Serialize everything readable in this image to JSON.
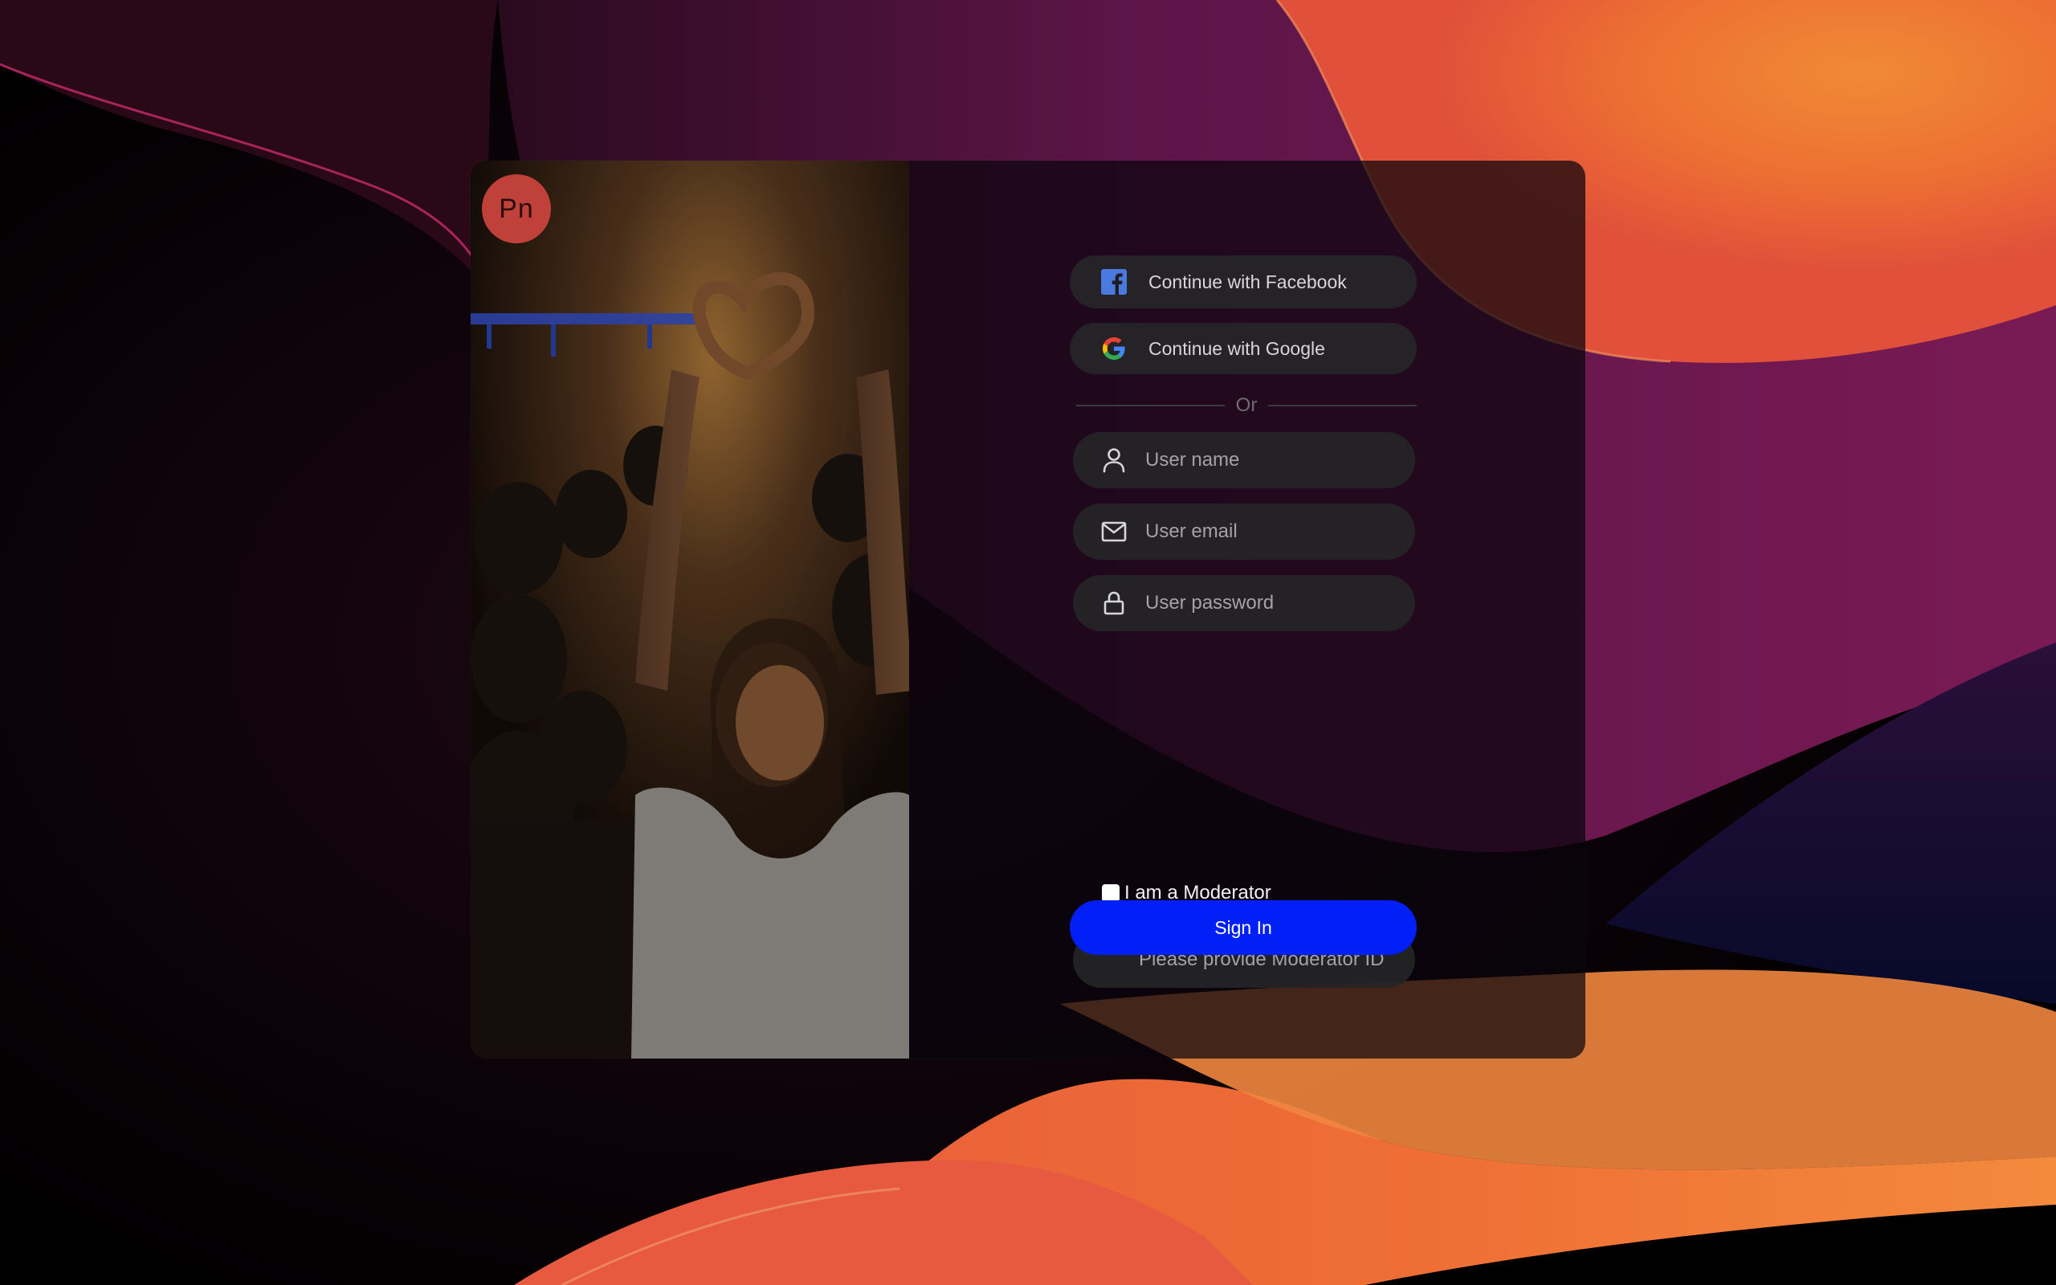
{
  "logo": {
    "text": "Pn"
  },
  "social": {
    "facebook_label": "Continue with Facebook",
    "google_label": "Continue with Google",
    "divider_text": "Or"
  },
  "fields": {
    "username_placeholder": "User name",
    "email_placeholder": "User email",
    "password_placeholder": "User password",
    "moderator_id_placeholder": "Please provide Moderator ID"
  },
  "moderator": {
    "label": "I am a Moderator",
    "checked": false
  },
  "signin": {
    "label": "Sign In"
  },
  "colors": {
    "accent_blue": "#0120f8",
    "logo_red": "#c0413a",
    "facebook_blue": "#4a7ae0"
  },
  "icons": {
    "facebook": "facebook-icon",
    "google": "google-icon",
    "user": "user-icon",
    "email": "mail-icon",
    "password": "lock-icon"
  }
}
